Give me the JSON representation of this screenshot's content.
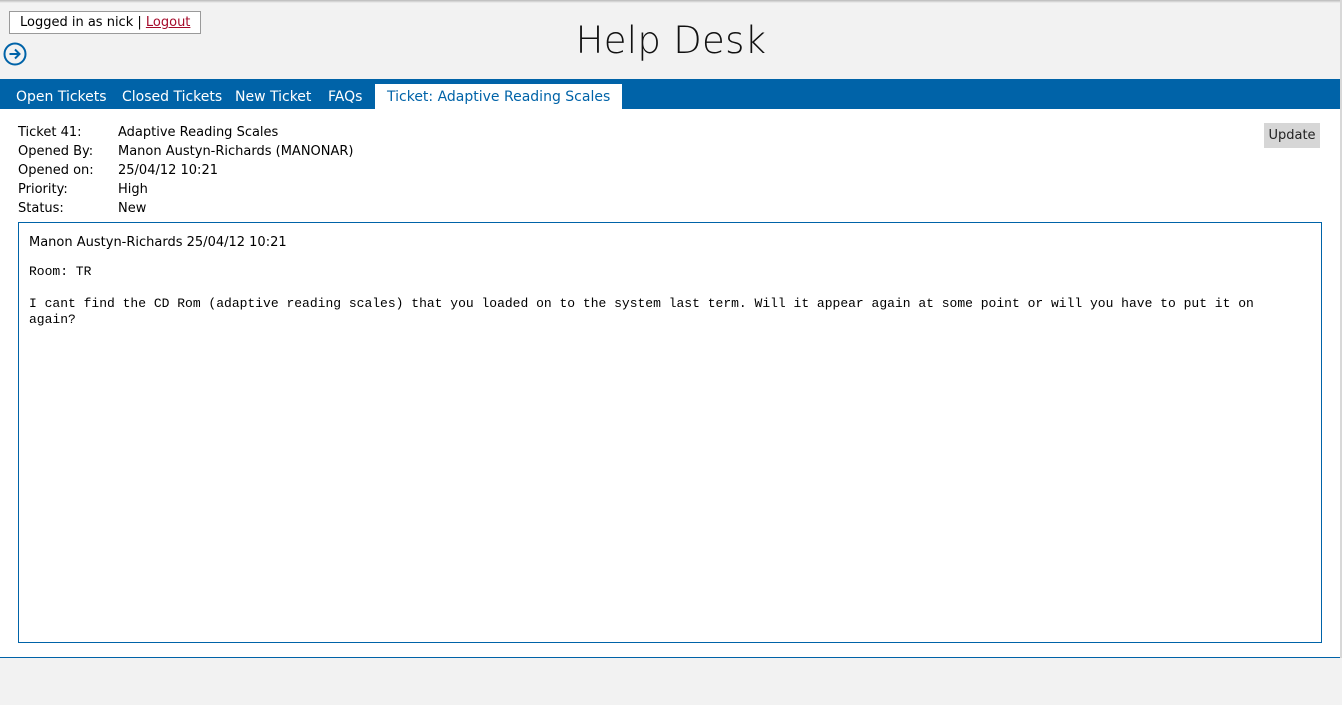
{
  "header": {
    "login_text": "Logged in as nick | ",
    "logout_label": "Logout",
    "title": "Help Desk",
    "nav_icon": "arrow-circle-right-icon"
  },
  "tabs": [
    {
      "label": "Open Tickets",
      "active": false
    },
    {
      "label": "Closed Tickets",
      "active": false
    },
    {
      "label": "New Ticket",
      "active": false
    },
    {
      "label": "FAQs",
      "active": false
    },
    {
      "label": "Ticket: Adaptive Reading Scales",
      "active": true
    }
  ],
  "ticket": {
    "fields": [
      {
        "label": "Ticket 41:",
        "value": "Adaptive Reading Scales"
      },
      {
        "label": "Opened By:",
        "value": "Manon Austyn-Richards (MANONAR)"
      },
      {
        "label": "Opened on:",
        "value": "25/04/12 10:21"
      },
      {
        "label": "Priority:",
        "value": "High"
      },
      {
        "label": "Status:",
        "value": "New"
      }
    ],
    "update_label": "Update"
  },
  "message": {
    "header": "Manon Austyn-Richards 25/04/12 10:21",
    "body": "Room: TR\n\nI cant find the CD Rom (adaptive reading scales) that you loaded on to the system last term. Will it appear again at some point or will you have to put it on again?"
  },
  "colors": {
    "accent": "#0063a8",
    "logout_link": "#a50a2a",
    "page_background": "#f2f2f2",
    "button_background": "#d6d6d6"
  }
}
